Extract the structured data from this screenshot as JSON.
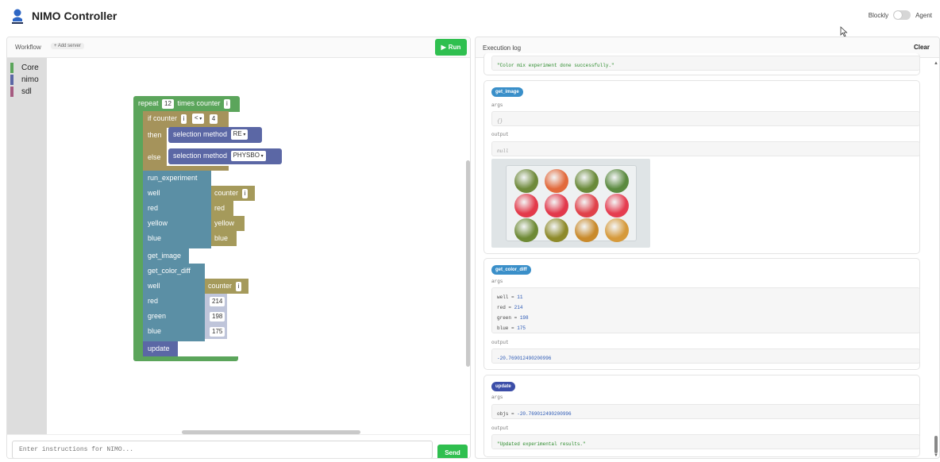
{
  "app": {
    "title": "NIMO Controller"
  },
  "mode": {
    "left_label": "Blockly",
    "right_label": "Agent"
  },
  "workflow": {
    "label": "Workflow",
    "add_server": "+ Add server",
    "run_label": "Run",
    "toolbox": [
      "Core",
      "nimo",
      "sdl"
    ],
    "toolbox_colors": [
      "#5ba55b",
      "#5b67a5",
      "#a55b80"
    ]
  },
  "blocks": {
    "repeat": "repeat",
    "repeat_count": "12",
    "times": "times",
    "counter": "counter",
    "i": "i",
    "if": "if",
    "op": "<",
    "cmp_value": "4",
    "then": "then",
    "else": "else",
    "selection": "selection",
    "method": "method",
    "method_then": "RE",
    "method_else": "PHYSBO",
    "run_experiment": "run_experiment",
    "well": "well",
    "red": "red",
    "yellow": "yellow",
    "blue": "blue",
    "green": "green",
    "get_image": "get_image",
    "get_color_diff": "get_color_diff",
    "red_value": "214",
    "green_value": "198",
    "blue_value": "175",
    "update": "update"
  },
  "input": {
    "placeholder": "Enter instructions for NIMO...",
    "send_label": "Send"
  },
  "log": {
    "title": "Execution log",
    "clear_label": "Clear",
    "top_output": "\"Color mix experiment done successfully.\"",
    "entries": [
      {
        "name": "get_image",
        "args_label": "args",
        "args": [
          "{}"
        ],
        "output_label": "output",
        "output": "null"
      },
      {
        "name": "get_color_diff",
        "args_label": "args",
        "args": [
          {
            "k": "well",
            "v": "11"
          },
          {
            "k": "red",
            "v": "214"
          },
          {
            "k": "green",
            "v": "198"
          },
          {
            "k": "blue",
            "v": "175"
          }
        ],
        "output_label": "output",
        "output": "-20.769012490200996"
      },
      {
        "name": "update",
        "args_label": "args",
        "args": [
          {
            "k": "objs",
            "v": "-20.769012490200996"
          }
        ],
        "output_label": "output",
        "output": "\"Updated experimental results.\""
      }
    ]
  },
  "colors": {
    "accent_green": "#2fbf4f",
    "block_loop": "#5ba55b",
    "block_logic": "#a5935b",
    "block_method": "#5b67a5",
    "block_nimo": "#5b8fa5",
    "block_var": "#a59a5b",
    "badge_blue": "#3a8fc9"
  },
  "image": {
    "well_colors": [
      [
        "#6f8a3b",
        "#e26a3c",
        "#6a8a3a",
        "#5b8a40"
      ],
      [
        "#e33a4a",
        "#e2394b",
        "#e0424a",
        "#e53d50"
      ],
      [
        "#6e8a35",
        "#8e8a2a",
        "#c98a2b",
        "#d69a3b"
      ]
    ]
  }
}
